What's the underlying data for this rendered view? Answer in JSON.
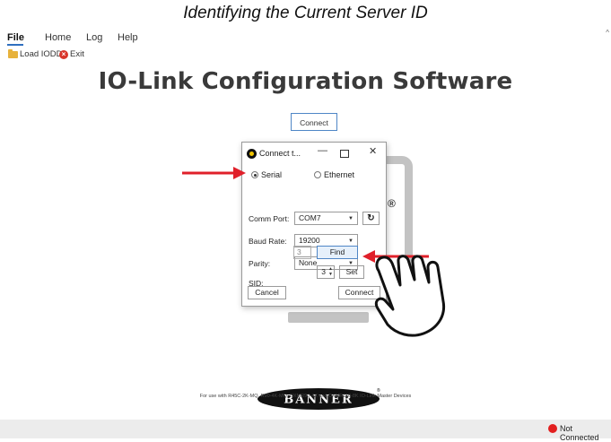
{
  "caption": "Identifying the Current Server ID",
  "menu": {
    "file": "File",
    "home": "Home",
    "log": "Log",
    "help": "Help"
  },
  "toolbar": {
    "load_iodd": "Load IODD",
    "exit": "Exit"
  },
  "app_title": "IO-Link Configuration Software",
  "main_connect_label": "Connect",
  "dialog": {
    "title": "Connect t...",
    "serial_label": "Serial",
    "ethernet_label": "Ethernet",
    "comm_port_label": "Comm Port:",
    "comm_port_value": "COM7",
    "baud_rate_label": "Baud Rate:",
    "baud_rate_value": "19200",
    "parity_label": "Parity:",
    "parity_value": "None",
    "sid_label": "SID:",
    "sid_value": "3",
    "find_label": "Find",
    "set_value": "3",
    "set_label": "Set",
    "cancel_label": "Cancel",
    "connect_label": "Connect"
  },
  "logo_text": "BANNER",
  "for_use_text": "For use with R45C-2K-MQ, R90-4K-MQ, DXMR90-4X and DXMR110-8K IO-Link Master Devices",
  "status": {
    "text": "Not Connected",
    "color": "#e21f1f"
  },
  "colors": {
    "accent": "#4f86c6",
    "arrow": "#e0202a"
  }
}
